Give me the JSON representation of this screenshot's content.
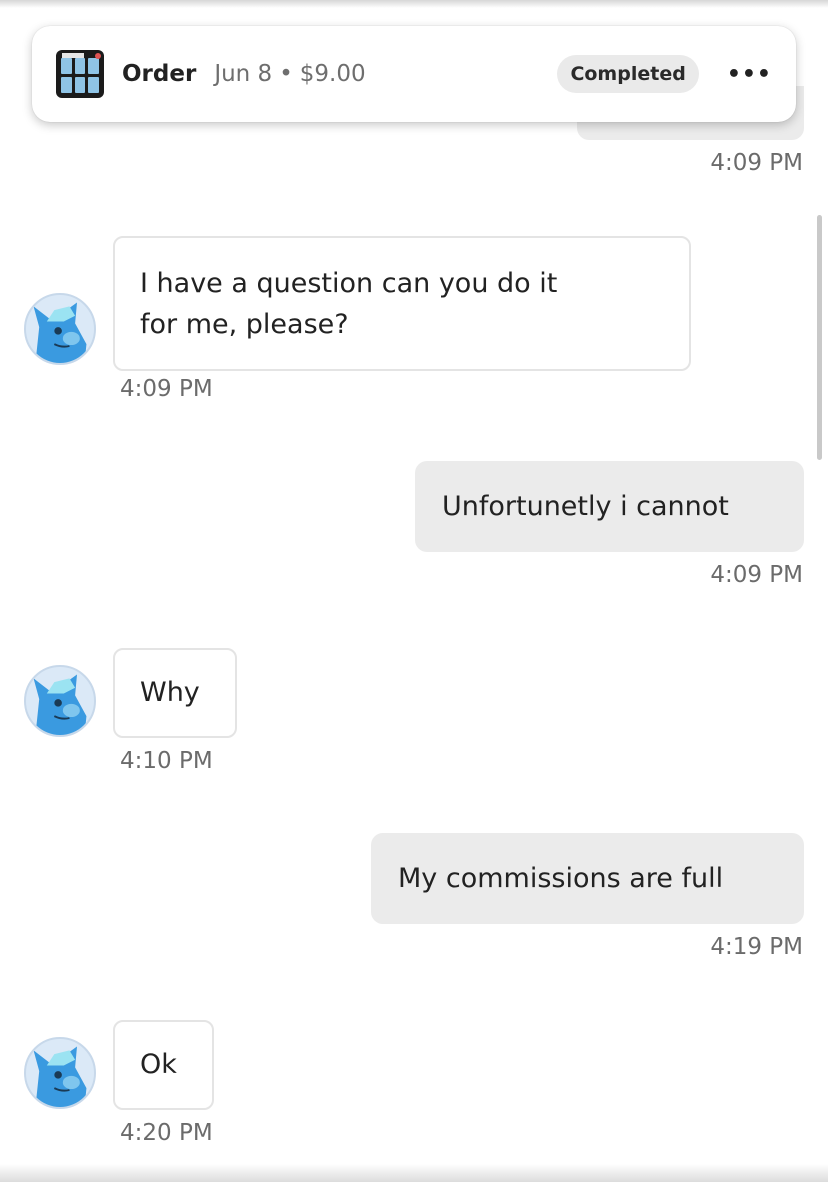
{
  "order": {
    "label": "Order",
    "date": "Jun 8",
    "separator": "•",
    "price": "$9.00",
    "status": "Completed",
    "more_icon": "more-horizontal-icon",
    "more_label": "•••"
  },
  "messages": [
    {
      "side": "out",
      "time": "4:09 PM"
    },
    {
      "side": "in",
      "text_line1": "I have a question can you do it",
      "text_line2": "for me, please?",
      "time": "4:09 PM"
    },
    {
      "side": "out",
      "text": "Unfortunetly i cannot",
      "time": "4:09 PM"
    },
    {
      "side": "in",
      "text": "Why",
      "time": "4:10 PM"
    },
    {
      "side": "out",
      "text": "My commissions are full",
      "time": "4:19 PM"
    },
    {
      "side": "in",
      "text": "Ok",
      "time": "4:20 PM"
    }
  ],
  "colors": {
    "incoming_bubble_bg": "#ffffff",
    "outgoing_bubble_bg": "#ebebeb",
    "timestamp": "#6b6b6b",
    "avatar_blue": "#3a9ae0"
  }
}
